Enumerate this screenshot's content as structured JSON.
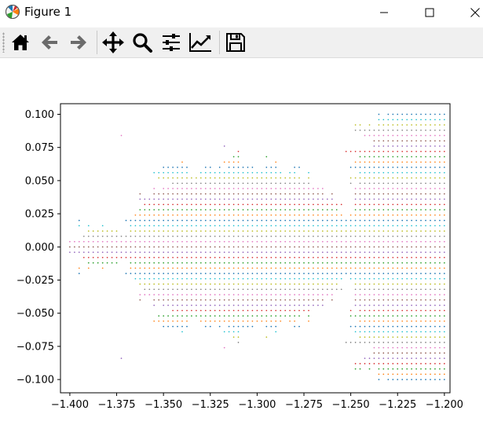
{
  "window": {
    "title": "Figure 1"
  },
  "toolbar": {
    "buttons": [
      {
        "name": "home-icon",
        "tooltip": "Home"
      },
      {
        "name": "back-icon",
        "tooltip": "Back"
      },
      {
        "name": "forward-icon",
        "tooltip": "Forward"
      },
      {
        "name": "pan-icon",
        "tooltip": "Pan"
      },
      {
        "name": "zoom-icon",
        "tooltip": "Zoom"
      },
      {
        "name": "subplots-icon",
        "tooltip": "Subplots"
      },
      {
        "name": "customize-icon",
        "tooltip": "Customize"
      },
      {
        "name": "save-icon",
        "tooltip": "Save"
      }
    ]
  },
  "chart_data": {
    "type": "scatter",
    "title": "",
    "xlabel": "",
    "ylabel": "",
    "xlim": [
      -1.405,
      -1.197
    ],
    "ylim": [
      -0.11,
      0.108
    ],
    "xticks": [
      -1.4,
      -1.375,
      -1.35,
      -1.325,
      -1.3,
      -1.275,
      -1.25,
      -1.225,
      -1.2
    ],
    "xtick_labels": [
      "−1.400",
      "−1.375",
      "−1.350",
      "−1.325",
      "−1.300",
      "−1.275",
      "−1.250",
      "−1.225",
      "−1.200"
    ],
    "yticks": [
      0.1,
      0.075,
      0.05,
      0.025,
      0.0,
      -0.025,
      -0.05,
      -0.075,
      -0.1
    ],
    "ytick_labels": [
      "0.100",
      "0.075",
      "0.050",
      "0.025",
      "0.000",
      "−0.025",
      "−0.050",
      "−0.075",
      "−0.100"
    ],
    "grid": false,
    "series_colors": [
      "#1f77b4",
      "#ff7f0e",
      "#2ca02c",
      "#d62728",
      "#9467bd",
      "#8c564b",
      "#e377c2",
      "#7f7f7f",
      "#bcbd22",
      "#17becf"
    ],
    "description": "Points of the Mandelbrot set on a regular grid over x in [-1.4, -1.2] and y in [-0.1, 0.1], one colored series per y row.",
    "grid_step_x": 0.0025,
    "grid_step_y": 0.004
  }
}
